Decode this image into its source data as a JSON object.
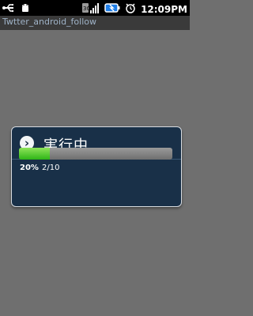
{
  "status": {
    "time": "12:09PM"
  },
  "titlebar": {
    "title": "Twtter_android_follow"
  },
  "dialog": {
    "title": "実行中",
    "progress_percent": 20,
    "percent_label": "20%",
    "count_label": "2/10"
  },
  "icons": {
    "usb": "usb-icon",
    "android": "android-icon",
    "signal": "signal-3g-icon",
    "battery": "battery-icon",
    "alarm": "alarm-icon",
    "chevron": "chevron-right-icon"
  }
}
